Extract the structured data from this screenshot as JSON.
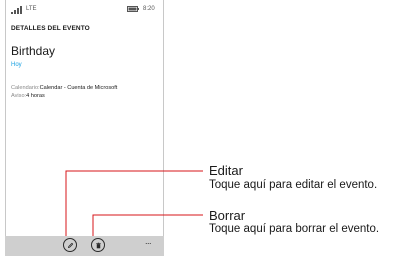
{
  "status_bar": {
    "network": "LTE",
    "time": "8:20",
    "signal_icon": "signal-bars-icon",
    "battery_icon": "battery-icon"
  },
  "screen": {
    "section_title": "DETALLES DEL EVENTO",
    "event_title": "Birthday",
    "event_date": "Hoy",
    "calendar_key": "Calendario:",
    "calendar_value": "Calendar - Cuenta de Microsoft",
    "reminder_key": "Aviso:",
    "reminder_value": "4 horas"
  },
  "app_bar": {
    "edit_icon": "pencil-icon",
    "delete_icon": "trash-icon",
    "more_label": "..."
  },
  "callouts": {
    "edit_title": "Editar",
    "edit_desc": "Toque aquí para editar el evento.",
    "delete_title": "Borrar",
    "delete_desc": "Toque aquí para borrar el evento.",
    "line_color": "#d7141a"
  },
  "colors": {
    "accent": "#1ba1e2",
    "app_bar_bg": "#cfcfcf"
  }
}
